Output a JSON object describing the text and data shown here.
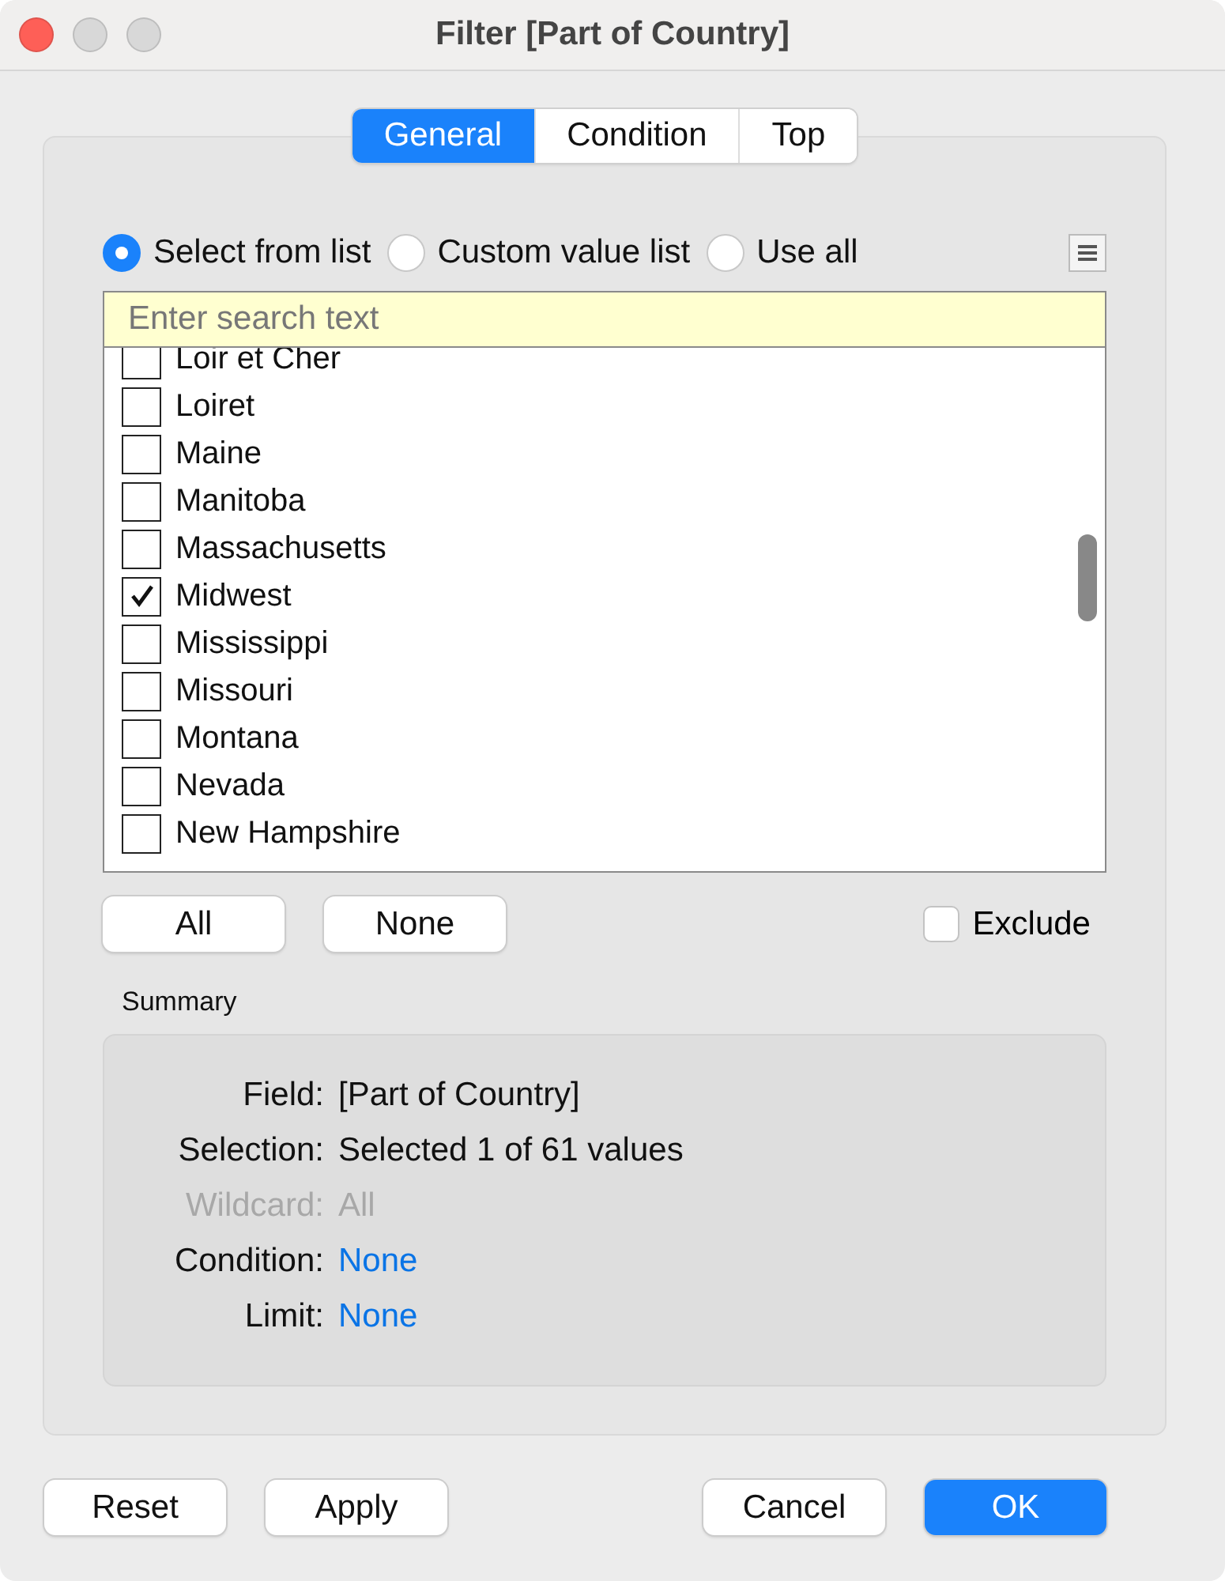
{
  "window": {
    "title": "Filter [Part of Country]"
  },
  "tabs": [
    {
      "label": "General",
      "selected": true
    },
    {
      "label": "Condition",
      "selected": false
    },
    {
      "label": "Top",
      "selected": false
    }
  ],
  "modes": [
    {
      "label": "Select from list",
      "selected": true
    },
    {
      "label": "Custom value list",
      "selected": false
    },
    {
      "label": "Use all",
      "selected": false
    }
  ],
  "search": {
    "placeholder": "Enter search text"
  },
  "items": [
    {
      "label": "Loir et Cher",
      "checked": false
    },
    {
      "label": "Loiret",
      "checked": false
    },
    {
      "label": "Maine",
      "checked": false
    },
    {
      "label": "Manitoba",
      "checked": false
    },
    {
      "label": "Massachusetts",
      "checked": false
    },
    {
      "label": "Midwest",
      "checked": true
    },
    {
      "label": "Mississippi",
      "checked": false
    },
    {
      "label": "Missouri",
      "checked": false
    },
    {
      "label": "Montana",
      "checked": false
    },
    {
      "label": "Nevada",
      "checked": false
    },
    {
      "label": "New Hampshire",
      "checked": false
    }
  ],
  "list_buttons": [
    "All",
    "None"
  ],
  "exclude": {
    "label": "Exclude",
    "checked": false
  },
  "summary": {
    "title": "Summary",
    "rows": [
      {
        "label": "Field:",
        "value": "[Part of Country]",
        "kind": "text"
      },
      {
        "label": "Selection:",
        "value": "Selected 1 of 61 values",
        "kind": "text"
      },
      {
        "label": "Wildcard:",
        "value": "All",
        "kind": "disabled"
      },
      {
        "label": "Condition:",
        "value": "None",
        "kind": "link"
      },
      {
        "label": "Limit:",
        "value": "None",
        "kind": "link"
      }
    ]
  },
  "footer": {
    "left": [
      "Reset",
      "Apply"
    ],
    "cancel": "Cancel",
    "ok": "OK"
  }
}
